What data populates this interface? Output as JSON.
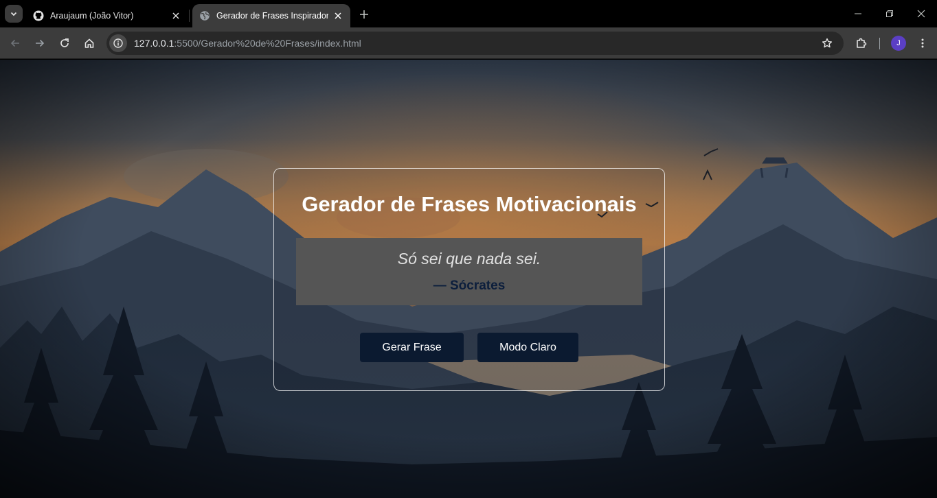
{
  "browser": {
    "tabs": [
      {
        "title": "Araujaum (João Vitor)",
        "favicon": "github-icon",
        "active": false
      },
      {
        "title": "Gerador de Frases Inspiradoras",
        "favicon": "globe-icon",
        "active": true
      }
    ],
    "url": {
      "host": "127.0.0.1",
      "rest": ":5500/Gerador%20de%20Frases/index.html"
    },
    "profile_initial": "J"
  },
  "page": {
    "title": "Gerador de Frases Motivacionais",
    "quote": "Só sei que nada sei.",
    "author": "— Sócrates",
    "buttons": {
      "generate": "Gerar Frase",
      "theme": "Modo Claro"
    }
  },
  "colors": {
    "button_bg": "#0b1a30",
    "quote_box_bg": "#555555",
    "author_text": "#0c1e3c"
  }
}
